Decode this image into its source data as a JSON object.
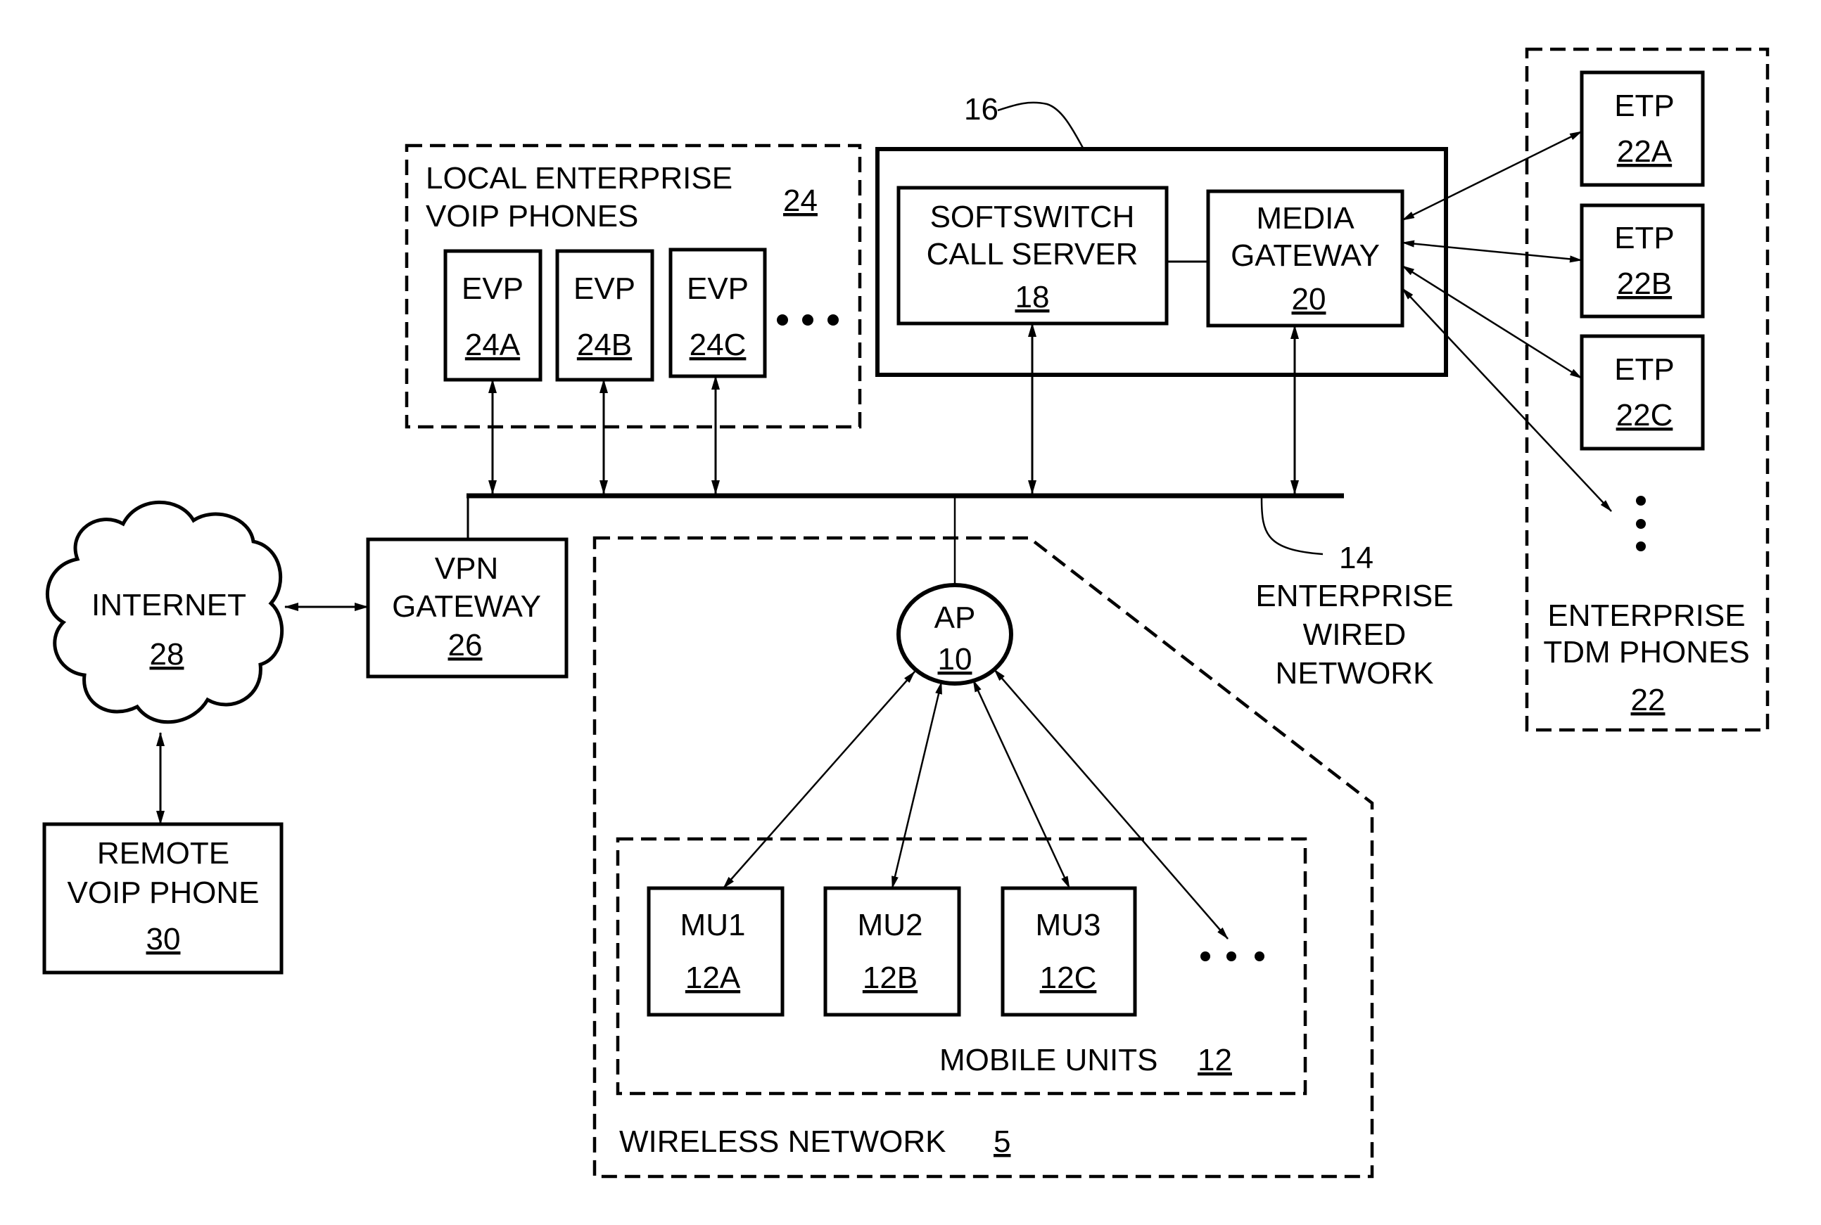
{
  "figure": {
    "local_enterprise": {
      "title_line1": "LOCAL ENTERPRISE",
      "title_line2": "VOIP PHONES",
      "ref": "24",
      "phones": [
        {
          "label": "EVP",
          "ref": "24A"
        },
        {
          "label": "EVP",
          "ref": "24B"
        },
        {
          "label": "EVP",
          "ref": "24C"
        }
      ],
      "ellipsis": "• • •"
    },
    "call_system": {
      "ref": "16",
      "softswitch": {
        "line1": "SOFTSWITCH",
        "line2": "CALL SERVER",
        "ref": "18"
      },
      "media_gateway": {
        "line1": "MEDIA",
        "line2": "GATEWAY",
        "ref": "20"
      }
    },
    "tdm_phones": {
      "title_line1": "ENTERPRISE",
      "title_line2": "TDM PHONES",
      "ref": "22",
      "phones": [
        {
          "label": "ETP",
          "ref": "22A"
        },
        {
          "label": "ETP",
          "ref": "22B"
        },
        {
          "label": "ETP",
          "ref": "22C"
        }
      ]
    },
    "wired_network": {
      "ref": "14",
      "line1": "ENTERPRISE",
      "line2": "WIRED",
      "line3": "NETWORK"
    },
    "vpn_gateway": {
      "line1": "VPN",
      "line2": "GATEWAY",
      "ref": "26"
    },
    "internet": {
      "label": "INTERNET",
      "ref": "28"
    },
    "remote_phone": {
      "line1": "REMOTE",
      "line2": "VOIP PHONE",
      "ref": "30"
    },
    "access_point": {
      "label": "AP",
      "ref": "10"
    },
    "mobile_units": {
      "title": "MOBILE UNITS",
      "ref": "12",
      "units": [
        {
          "label": "MU1",
          "ref": "12A"
        },
        {
          "label": "MU2",
          "ref": "12B"
        },
        {
          "label": "MU3",
          "ref": "12C"
        }
      ],
      "ellipsis": "• • •"
    },
    "wireless_network": {
      "title": "WIRELESS NETWORK",
      "ref": "5"
    }
  }
}
